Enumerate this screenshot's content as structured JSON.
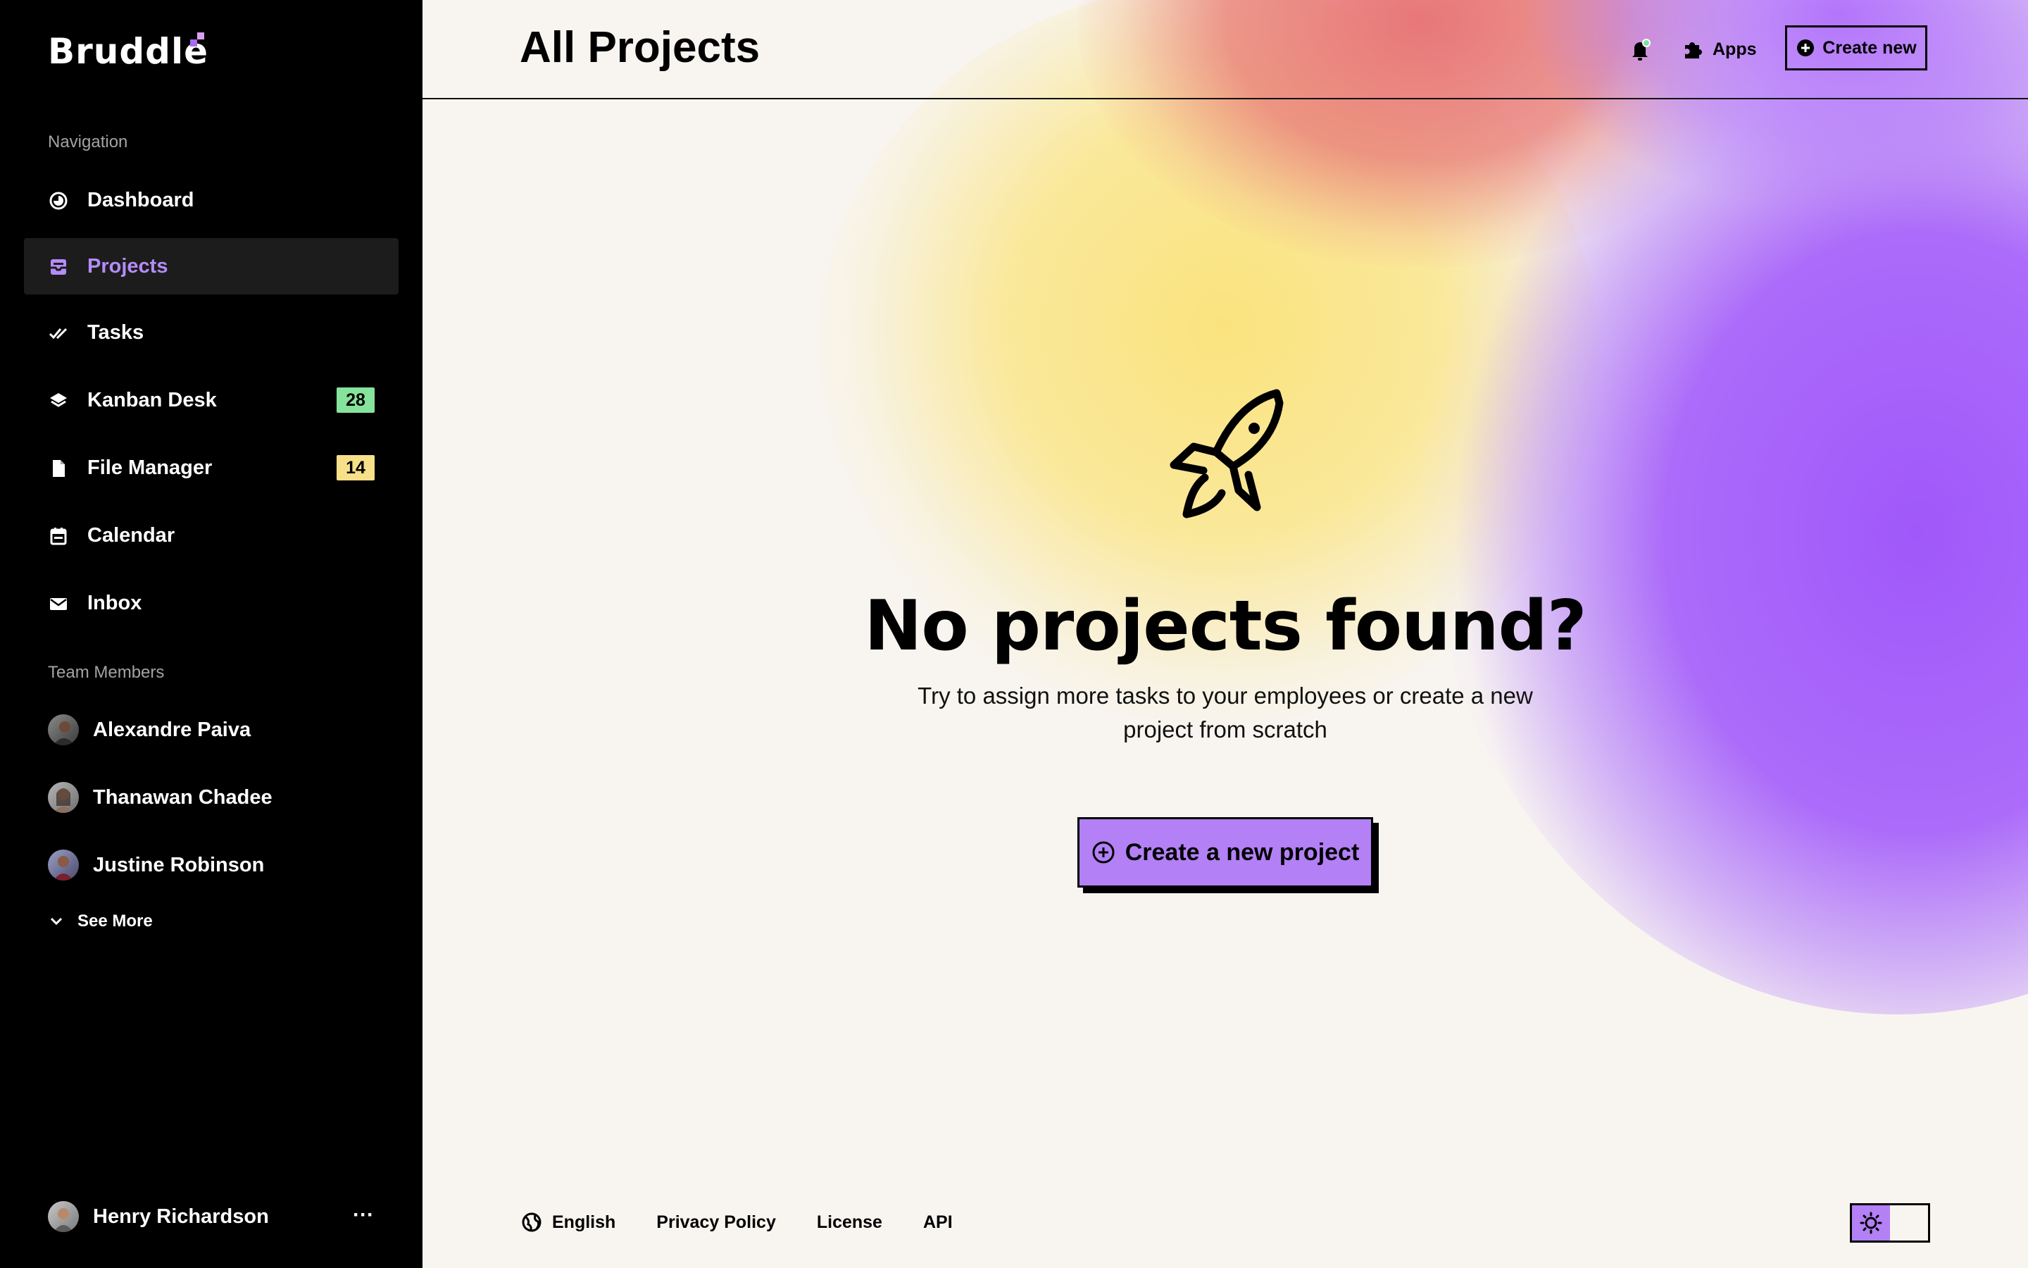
{
  "app": {
    "logo_text": "Bruddle"
  },
  "sidebar": {
    "navigation_label": "Navigation",
    "items": [
      {
        "label": "Dashboard",
        "icon": "dashboard-icon",
        "active": false
      },
      {
        "label": "Projects",
        "icon": "inbox-tray-icon",
        "active": true
      },
      {
        "label": "Tasks",
        "icon": "double-check-icon",
        "active": false
      },
      {
        "label": "Kanban Desk",
        "icon": "layers-icon",
        "badge": "28",
        "badge_color": "#86e39b"
      },
      {
        "label": "File Manager",
        "icon": "file-icon",
        "badge": "14",
        "badge_color": "#f8e08a"
      },
      {
        "label": "Calendar",
        "icon": "calendar-icon",
        "active": false
      },
      {
        "label": "Inbox",
        "icon": "mail-icon",
        "active": false
      }
    ],
    "team_label": "Team Members",
    "members": [
      {
        "name": "Alexandre Paiva"
      },
      {
        "name": "Thanawan Chadee"
      },
      {
        "name": "Justine Robinson"
      }
    ],
    "see_more": "See More",
    "current_user": {
      "name": "Henry Richardson"
    }
  },
  "header": {
    "title": "All Projects",
    "apps_label": "Apps",
    "create_label": "Create new"
  },
  "empty_state": {
    "icon": "rocket-icon",
    "title": "No projects found?",
    "line1": "Try to assign more tasks to your employees or create a new",
    "line2": "project from scratch",
    "cta_label": "Create a new project"
  },
  "footer": {
    "language": "English",
    "links": [
      "Privacy Policy",
      "License",
      "API"
    ]
  },
  "colors": {
    "accent": "#b380f6",
    "active_nav_text": "#b48cf8",
    "sidebar_bg": "#000000",
    "page_bg": "#f8f5f0"
  }
}
